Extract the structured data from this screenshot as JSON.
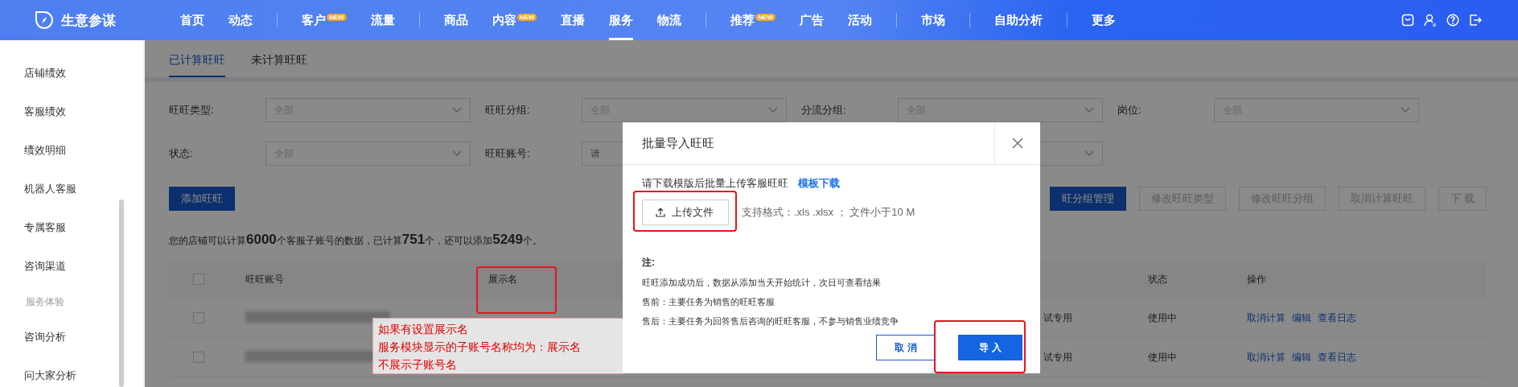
{
  "nav": {
    "brand": "生意参谋",
    "groups": [
      [
        {
          "label": "首页",
          "selected": false
        },
        {
          "label": "动态",
          "selected": false
        }
      ],
      [
        {
          "label": "客户",
          "badge": "NEW",
          "selected": false
        },
        {
          "label": "流量",
          "selected": false
        }
      ],
      [
        {
          "label": "商品",
          "selected": false
        },
        {
          "label": "内容",
          "badge": "NEW",
          "selected": false
        },
        {
          "label": "直播",
          "selected": false
        },
        {
          "label": "服务",
          "selected": true
        },
        {
          "label": "物流",
          "selected": false
        }
      ],
      [
        {
          "label": "推荐",
          "badge": "NEW",
          "selected": false
        },
        {
          "label": "广告",
          "selected": false
        },
        {
          "label": "活动",
          "selected": false
        }
      ],
      [
        {
          "label": "市场",
          "selected": false
        }
      ],
      [
        {
          "label": "自助分析",
          "selected": false
        }
      ],
      [
        {
          "label": "更多",
          "selected": false
        }
      ]
    ]
  },
  "sidebar": {
    "items": [
      {
        "kind": "item",
        "label": "店铺绩效"
      },
      {
        "kind": "item",
        "label": "客服绩效"
      },
      {
        "kind": "item",
        "label": "绩效明细"
      },
      {
        "kind": "item",
        "label": "机器人客服"
      },
      {
        "kind": "item",
        "label": "专属客服"
      },
      {
        "kind": "item",
        "label": "咨询渠道"
      },
      {
        "kind": "heading",
        "label": "服务体验"
      },
      {
        "kind": "item",
        "label": "咨询分析"
      },
      {
        "kind": "item",
        "label": "问大家分析"
      }
    ]
  },
  "tabs": [
    {
      "label": "已计算旺旺",
      "selected": true
    },
    {
      "label": "未计算旺旺",
      "selected": false
    }
  ],
  "filters": [
    {
      "kind": "select",
      "label": "旺旺类型:",
      "placeholder": "全部"
    },
    {
      "kind": "select",
      "label": "旺旺分组:",
      "placeholder": "全部"
    },
    {
      "kind": "select",
      "label": "分流分组:",
      "placeholder": "全部"
    },
    {
      "kind": "select",
      "label": "岗位:",
      "placeholder": "全部"
    },
    {
      "kind": "select",
      "label": "状态:",
      "placeholder": "全部"
    },
    {
      "kind": "input",
      "label": "旺旺账号:",
      "placeholder": "请"
    },
    {
      "kind": "select"
    }
  ],
  "add_button": "添加旺旺",
  "actions": [
    {
      "label": "旺分组管理",
      "primary": true,
      "disabled": false
    },
    {
      "label": "修改旺旺类型",
      "primary": false,
      "disabled": true
    },
    {
      "label": "修改旺旺分组",
      "primary": false,
      "disabled": true
    },
    {
      "label": "取消计算旺旺",
      "primary": false,
      "disabled": true
    },
    {
      "label": "下 载",
      "primary": false,
      "disabled": true
    }
  ],
  "quota": "您的店铺可以计算**6000**个客服子账号的数据，已计算**751**个，还可以添加**5249**个。",
  "table": {
    "header_checked": false,
    "columns": [
      "旺旺账号",
      "展示名",
      "状态",
      "操作"
    ],
    "rows": [
      {
        "checked": false,
        "column_4": "试专用",
        "status": "使用中",
        "links": [
          "取消计算",
          "编辑",
          "查看日志"
        ]
      },
      {
        "checked": false,
        "column_4": "试专用",
        "status": "使用中",
        "links": [
          "取消计算",
          "编辑",
          "查看日志"
        ]
      }
    ]
  },
  "annotation": {
    "lines": [
      "如果有设置展示名",
      "服务模块显示的子账号名称均为：展示名",
      "不展示子账号名"
    ]
  },
  "modal": {
    "title": "批量导入旺旺",
    "instruction": "请下载模版后批量上传客服旺旺",
    "template_link": "模板下载",
    "upload_button": "上传文件",
    "formats": "支持格式：.xls .xlsx ； 文件小于10 M",
    "note_title": "注:",
    "notes": [
      "旺旺添加成功后，数据从添加当天开始统计，次日可查看结果",
      "售前：主要任务为销售的旺旺客服",
      "售后：主要任务为回答售后咨询的旺旺客服，不参与销售业绩竞争"
    ],
    "cancel": "取 消",
    "confirm": "导 入"
  }
}
